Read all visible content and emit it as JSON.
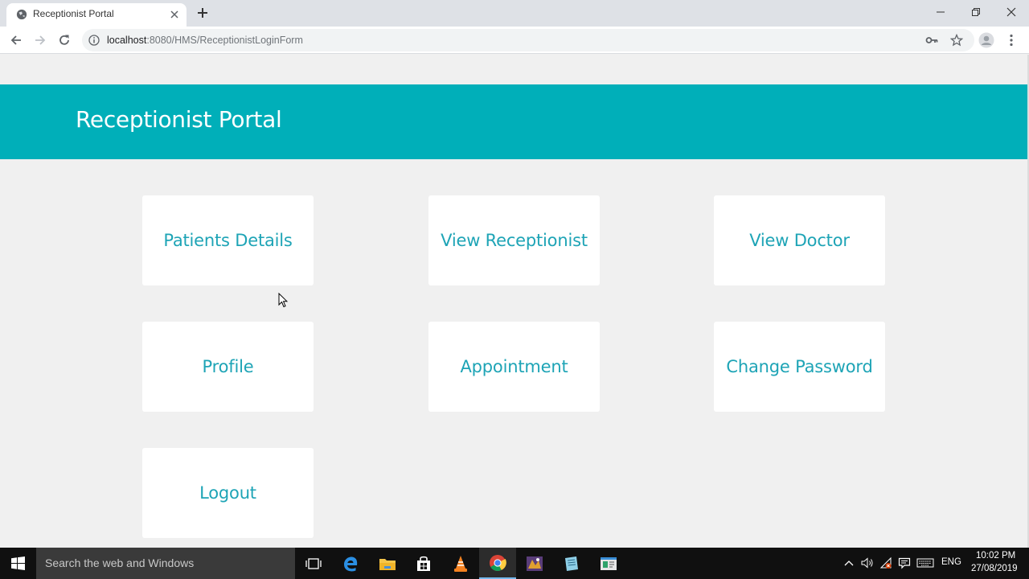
{
  "browser": {
    "tab_title": "Receptionist Portal",
    "url_host": "localhost",
    "url_rest": ":8080/HMS/ReceptionistLoginForm"
  },
  "page": {
    "banner_title": "Receptionist Portal",
    "colors": {
      "banner": "#00afb9",
      "card_text": "#1ea4b6",
      "background": "#f0f0f0"
    },
    "cards": [
      {
        "label": "Patients Details"
      },
      {
        "label": "View Receptionist"
      },
      {
        "label": "View Doctor"
      },
      {
        "label": "Profile"
      },
      {
        "label": "Appointment"
      },
      {
        "label": "Change Password"
      },
      {
        "label": "Logout"
      }
    ]
  },
  "taskbar": {
    "search_placeholder": "Search the web and Windows",
    "language": "ENG",
    "time": "10:02 PM",
    "date": "27/08/2019"
  }
}
